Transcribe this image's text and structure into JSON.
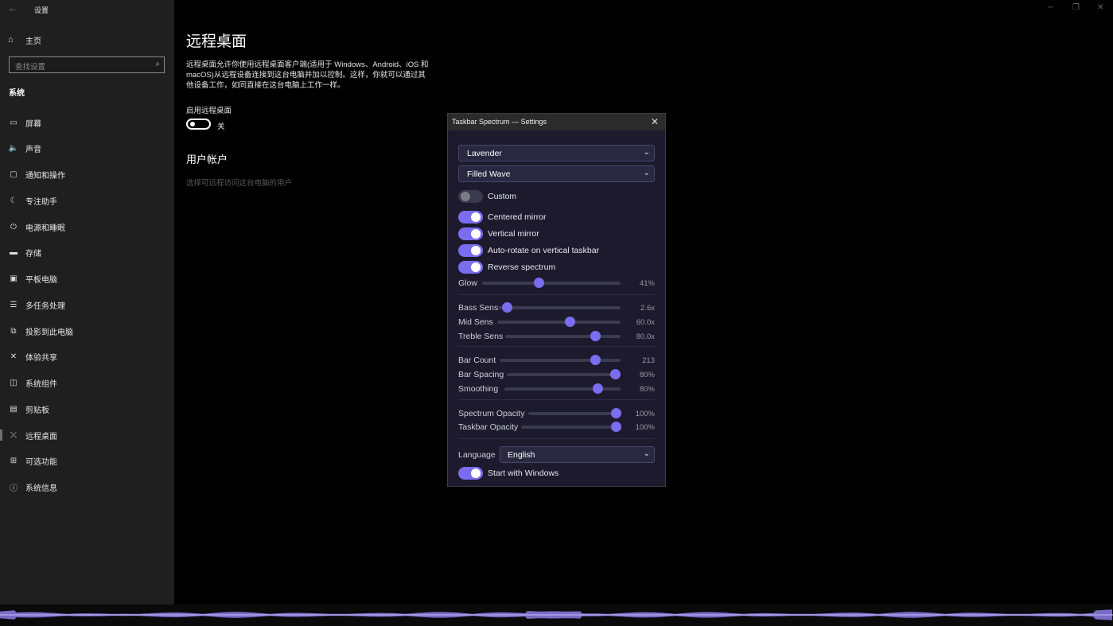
{
  "window": {
    "app_title": "设置",
    "back_icon": "back-arrow-icon"
  },
  "sidebar": {
    "home_label": "主页",
    "search_placeholder": "查找设置",
    "section_title": "系统",
    "items": [
      {
        "icon": "monitor-icon",
        "label": "屏幕"
      },
      {
        "icon": "speaker-icon",
        "label": "声音"
      },
      {
        "icon": "notification-icon",
        "label": "通知和操作"
      },
      {
        "icon": "moon-icon",
        "label": "专注助手"
      },
      {
        "icon": "power-icon",
        "label": "电源和睡眠"
      },
      {
        "icon": "storage-icon",
        "label": "存储"
      },
      {
        "icon": "tablet-icon",
        "label": "平板电脑"
      },
      {
        "icon": "multitask-icon",
        "label": "多任务处理"
      },
      {
        "icon": "project-icon",
        "label": "投影到此电脑"
      },
      {
        "icon": "share-icon",
        "label": "体验共享"
      },
      {
        "icon": "components-icon",
        "label": "系统组件"
      },
      {
        "icon": "clipboard-icon",
        "label": "剪贴板"
      },
      {
        "icon": "remote-icon",
        "label": "远程桌面"
      },
      {
        "icon": "features-icon",
        "label": "可选功能"
      },
      {
        "icon": "info-icon",
        "label": "系统信息"
      }
    ],
    "active_index": 12
  },
  "main": {
    "title": "远程桌面",
    "description": "远程桌面允许你使用远程桌面客户端(适用于 Windows、Android、iOS 和 macOS)从远程设备连接到这台电脑并加以控制。这样，你就可以通过其他设备工作，如同直接在这台电脑上工作一样。",
    "toggle_label": "启用远程桌面",
    "toggle_state": "关",
    "toggle_on": false,
    "user_section_title": "用户帐户",
    "user_link": "选择可远程访问这台电脑的用户"
  },
  "dialog": {
    "title": "Taskbar Spectrum — Settings",
    "theme_select": "Lavender",
    "style_select": "Filled Wave",
    "toggles": [
      {
        "label": "Custom",
        "on": false
      },
      {
        "label": "Centered mirror",
        "on": true
      },
      {
        "label": "Vertical mirror",
        "on": true
      },
      {
        "label": "Auto-rotate on vertical taskbar",
        "on": true
      },
      {
        "label": "Reverse spectrum",
        "on": true
      }
    ],
    "sliders": {
      "glow": {
        "label": "Glow",
        "value": "41%",
        "fraction": 0.41
      },
      "bass": {
        "label": "Bass Sens",
        "value": "2.6x",
        "fraction": 0.07
      },
      "mid": {
        "label": "Mid Sens",
        "value": "60.0x",
        "fraction": 0.59
      },
      "treble": {
        "label": "Treble Sens",
        "value": "80.0x",
        "fraction": 0.78
      },
      "bar_count": {
        "label": "Bar Count",
        "value": "213",
        "fraction": 0.79
      },
      "bar_spacing": {
        "label": "Bar Spacing",
        "value": "80%",
        "fraction": 0.95
      },
      "smoothing": {
        "label": "Smoothing",
        "value": "80%",
        "fraction": 0.8
      },
      "spectrum_opacity": {
        "label": "Spectrum Opacity",
        "value": "100%",
        "fraction": 0.95
      },
      "taskbar_opacity": {
        "label": "Taskbar Opacity",
        "value": "100%",
        "fraction": 0.95
      }
    },
    "language_label": "Language",
    "language_value": "English",
    "startup_label": "Start with Windows",
    "startup_on": true
  },
  "colors": {
    "accent": "#7a6df0",
    "sidebar_bg": "#1f1f1f",
    "dialog_bg": "#1c1a2c"
  }
}
